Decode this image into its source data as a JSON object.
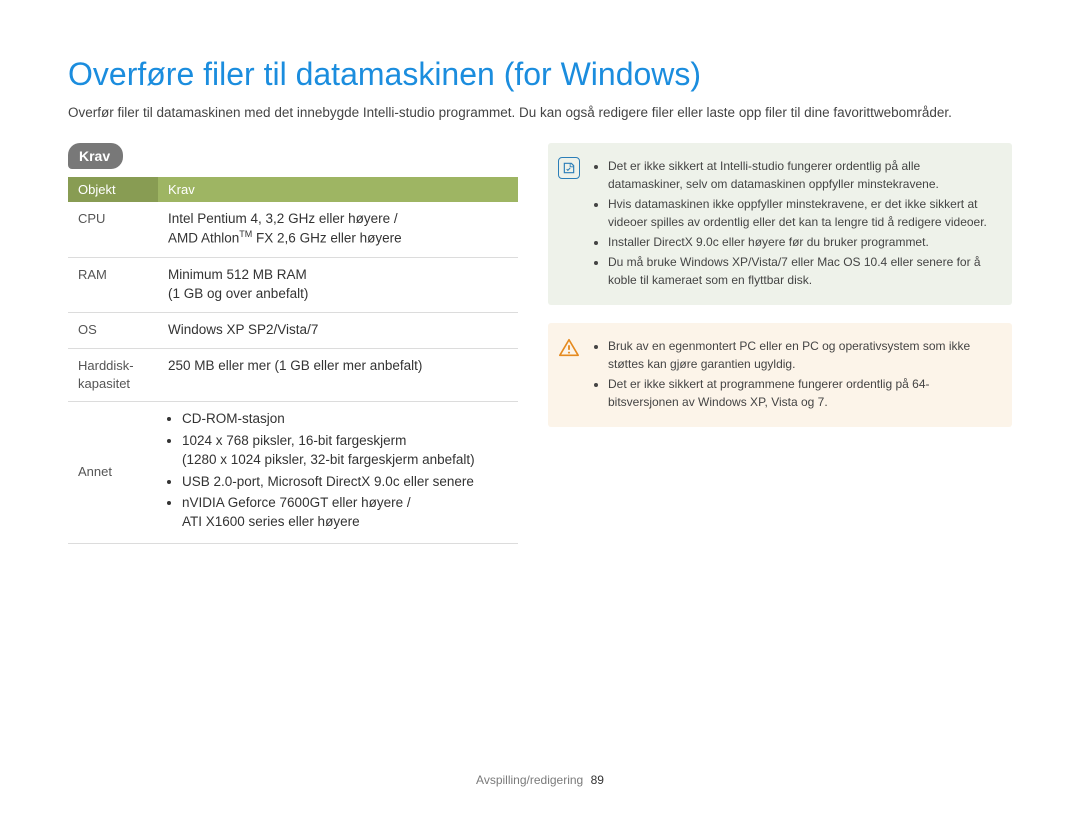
{
  "title": "Overføre filer til datamaskinen (for Windows)",
  "intro": "Overfør filer til datamaskinen med det innebygde Intelli-studio programmet. Du kan også redigere filer eller laste opp filer til dine favorittwebområder.",
  "section_badge": "Krav",
  "table": {
    "head": {
      "col1": "Objekt",
      "col2": "Krav"
    },
    "rows": {
      "cpu": {
        "label": "CPU",
        "line1": "Intel Pentium 4, 3,2 GHz eller høyere /",
        "line2_pre": "AMD Athlon",
        "line2_tm": "TM",
        "line2_post": " FX 2,6 GHz eller høyere"
      },
      "ram": {
        "label": "RAM",
        "line1": "Minimum 512 MB RAM",
        "line2": "(1 GB og over anbefalt)"
      },
      "os": {
        "label": "OS",
        "value": "Windows XP SP2/Vista/7"
      },
      "hdd": {
        "label1": "Harddisk-",
        "label2": "kapasitet",
        "value": "250 MB eller mer (1 GB eller mer anbefalt)"
      },
      "other": {
        "label": "Annet",
        "li1": "CD-ROM-stasjon",
        "li2a": "1024 x 768 piksler, 16-bit fargeskjerm",
        "li2b": "(1280 x 1024 piksler, 32-bit fargeskjerm anbefalt)",
        "li3": "USB 2.0-port, Microsoft DirectX 9.0c eller senere",
        "li4a": "nVIDIA Geforce 7600GT eller høyere /",
        "li4b": "ATI X1600 series eller høyere"
      }
    }
  },
  "callout_info": {
    "li1": "Det er ikke sikkert at Intelli-studio fungerer ordentlig på alle datamaskiner, selv om datamaskinen oppfyller minstekravene.",
    "li2": "Hvis datamaskinen ikke oppfyller minstekravene, er det ikke sikkert at videoer spilles av ordentlig eller det kan ta lengre tid å redigere videoer.",
    "li3": "Installer DirectX 9.0c eller høyere før du bruker programmet.",
    "li4": "Du må bruke Windows XP/Vista/7 eller Mac OS 10.4 eller senere for å koble til kameraet som en flyttbar disk."
  },
  "callout_warn": {
    "li1": "Bruk av en egenmontert PC eller en PC og operativsystem som ikke støttes kan gjøre garantien ugyldig.",
    "li2": "Det er ikke sikkert at programmene fungerer ordentlig på 64-bitsversjonen av Windows XP, Vista og 7."
  },
  "footer": {
    "section": "Avspilling/redigering",
    "page": "89"
  },
  "icons": {
    "note": "note-icon",
    "warning": "warning-icon"
  }
}
